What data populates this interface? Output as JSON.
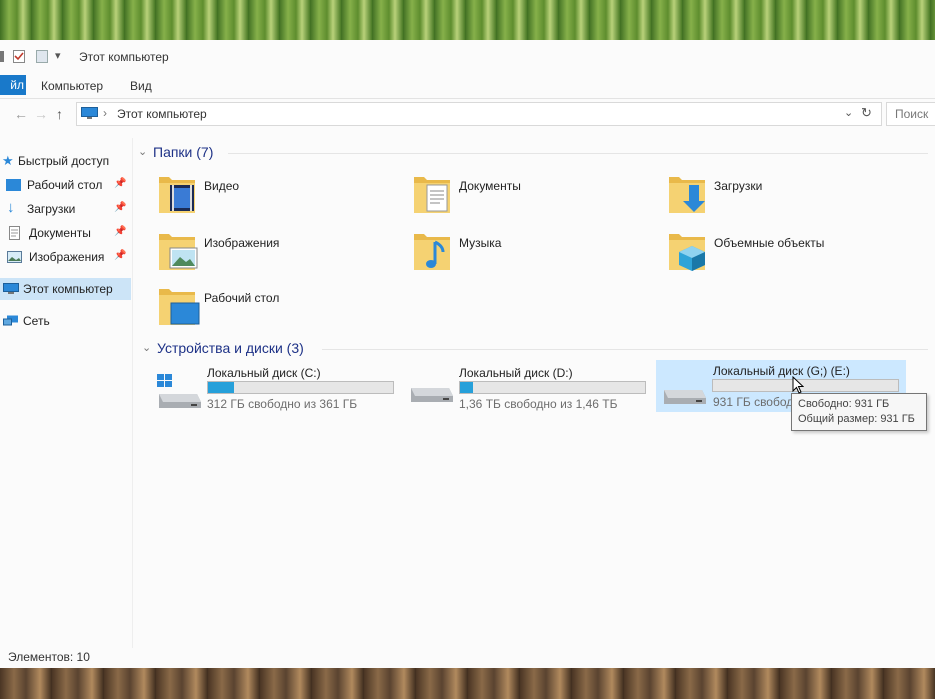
{
  "window": {
    "title": "Этот компьютер"
  },
  "ribbon": {
    "tabs": [
      {
        "label": "йл"
      },
      {
        "label": "Компьютер"
      },
      {
        "label": "Вид"
      }
    ]
  },
  "address": {
    "path": "Этот компьютер",
    "search_placeholder": "Поиск"
  },
  "sidebar": {
    "items": [
      {
        "label": "Быстрый доступ"
      },
      {
        "label": "Рабочий стол"
      },
      {
        "label": "Загрузки"
      },
      {
        "label": "Документы"
      },
      {
        "label": "Изображения"
      },
      {
        "label": "Этот компьютер"
      },
      {
        "label": "Сеть"
      }
    ]
  },
  "folders_group": {
    "title": "Папки (7)",
    "items": [
      {
        "label": "Видео",
        "icon": "video-folder-icon"
      },
      {
        "label": "Документы",
        "icon": "documents-folder-icon"
      },
      {
        "label": "Загрузки",
        "icon": "downloads-folder-icon"
      },
      {
        "label": "Изображения",
        "icon": "pictures-folder-icon"
      },
      {
        "label": "Музыка",
        "icon": "music-folder-icon"
      },
      {
        "label": "Объемные объекты",
        "icon": "3d-objects-folder-icon"
      },
      {
        "label": "Рабочий стол",
        "icon": "desktop-folder-icon"
      }
    ]
  },
  "drives_group": {
    "title": "Устройства и диски (3)",
    "items": [
      {
        "name": "Локальный диск (C:)",
        "free": "312 ГБ свободно из 361 ГБ",
        "used_fraction": 0.14
      },
      {
        "name": "Локальный диск (D:)",
        "free": "1,36 ТБ свободно из 1,46 ТБ",
        "used_fraction": 0.07
      },
      {
        "name": "Локальный диск (G;) (E:)",
        "free": "931 ГБ свободно",
        "used_fraction": 0.0
      }
    ]
  },
  "tooltip": {
    "line1": "Свободно: 931 ГБ",
    "line2": "Общий размер: 931 ГБ"
  },
  "status": {
    "text": "Элементов: 10"
  },
  "colors": {
    "accent": "#1979ca",
    "folder": "#f1c75a",
    "selection": "#cce8ff",
    "bar_fill": "#26a0da"
  }
}
